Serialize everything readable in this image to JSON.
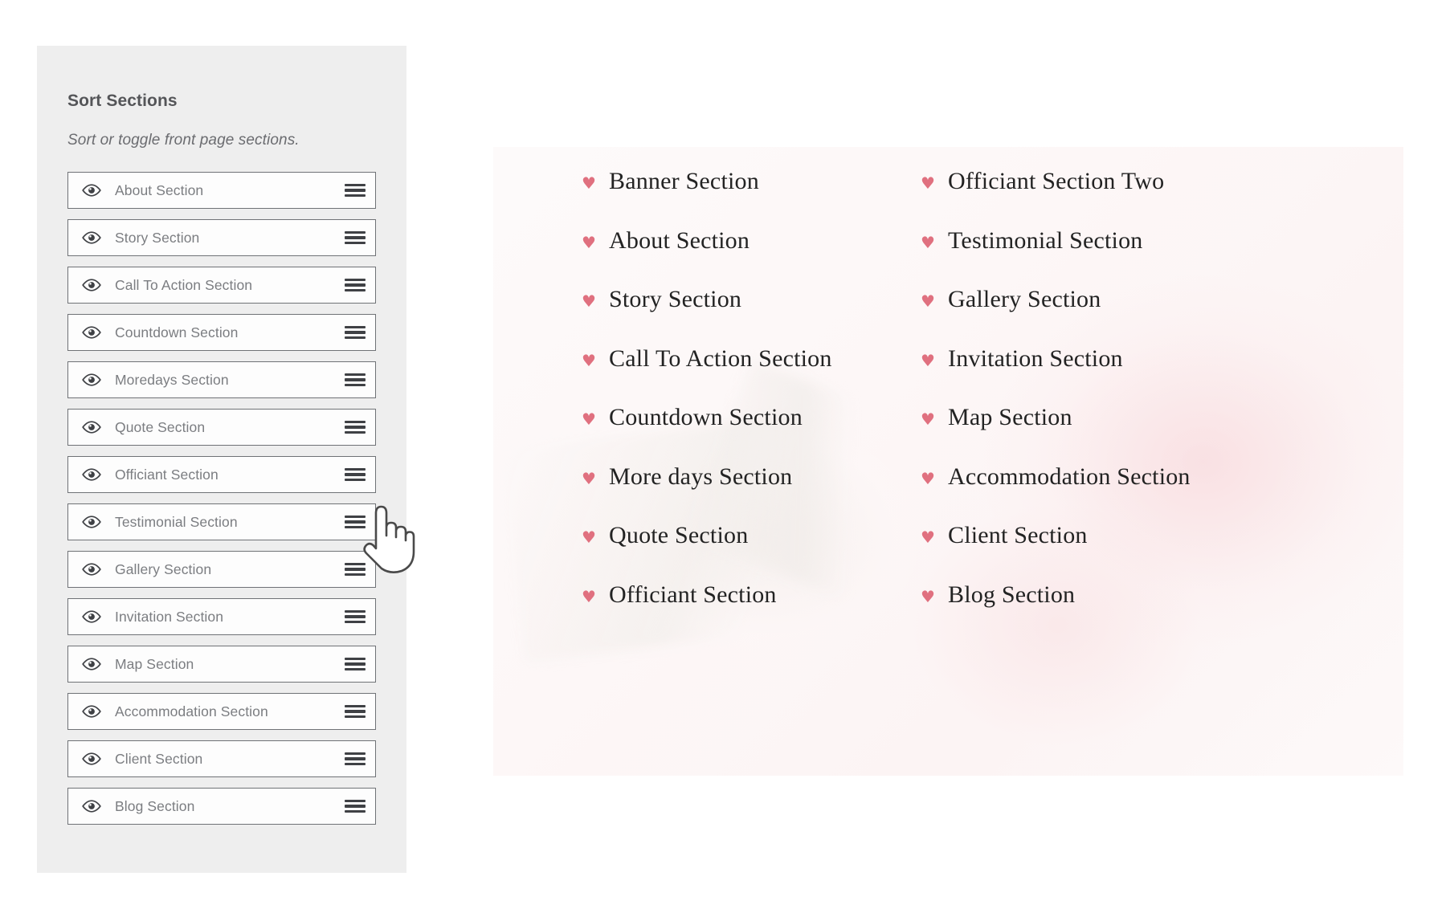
{
  "sort_panel": {
    "title": "Sort Sections",
    "subtitle": "Sort or toggle front page sections.",
    "visibility_icon": "eye-icon",
    "drag_handle_icon": "hamburger-drag-handle-icon",
    "items": [
      {
        "label": "About Section"
      },
      {
        "label": "Story Section"
      },
      {
        "label": "Call To Action Section"
      },
      {
        "label": "Countdown Section"
      },
      {
        "label": "Moredays Section"
      },
      {
        "label": "Quote Section"
      },
      {
        "label": "Officiant Section"
      },
      {
        "label": "Testimonial Section"
      },
      {
        "label": "Gallery Section"
      },
      {
        "label": "Invitation Section"
      },
      {
        "label": "Map Section"
      },
      {
        "label": "Accommodation Section"
      },
      {
        "label": "Client Section"
      },
      {
        "label": "Blog Section"
      }
    ]
  },
  "preview": {
    "bullet_icon": "heart-icon",
    "bullet_glyph": "♥",
    "accent_color": "#e0707f",
    "text_color": "#232323",
    "left_column": [
      {
        "label": "Banner Section"
      },
      {
        "label": "About Section"
      },
      {
        "label": "Story Section"
      },
      {
        "label": "Call To Action Section"
      },
      {
        "label": "Countdown Section"
      },
      {
        "label": "More days Section"
      },
      {
        "label": "Quote Section"
      },
      {
        "label": "Officiant Section"
      }
    ],
    "right_column": [
      {
        "label": "Officiant Section Two"
      },
      {
        "label": "Testimonial Section"
      },
      {
        "label": "Gallery Section"
      },
      {
        "label": "Invitation Section"
      },
      {
        "label": "Map Section"
      },
      {
        "label": "Accommodation Section"
      },
      {
        "label": "Client Section"
      },
      {
        "label": "Blog Section"
      }
    ]
  },
  "cursor": {
    "type": "pointing-hand-cursor"
  }
}
